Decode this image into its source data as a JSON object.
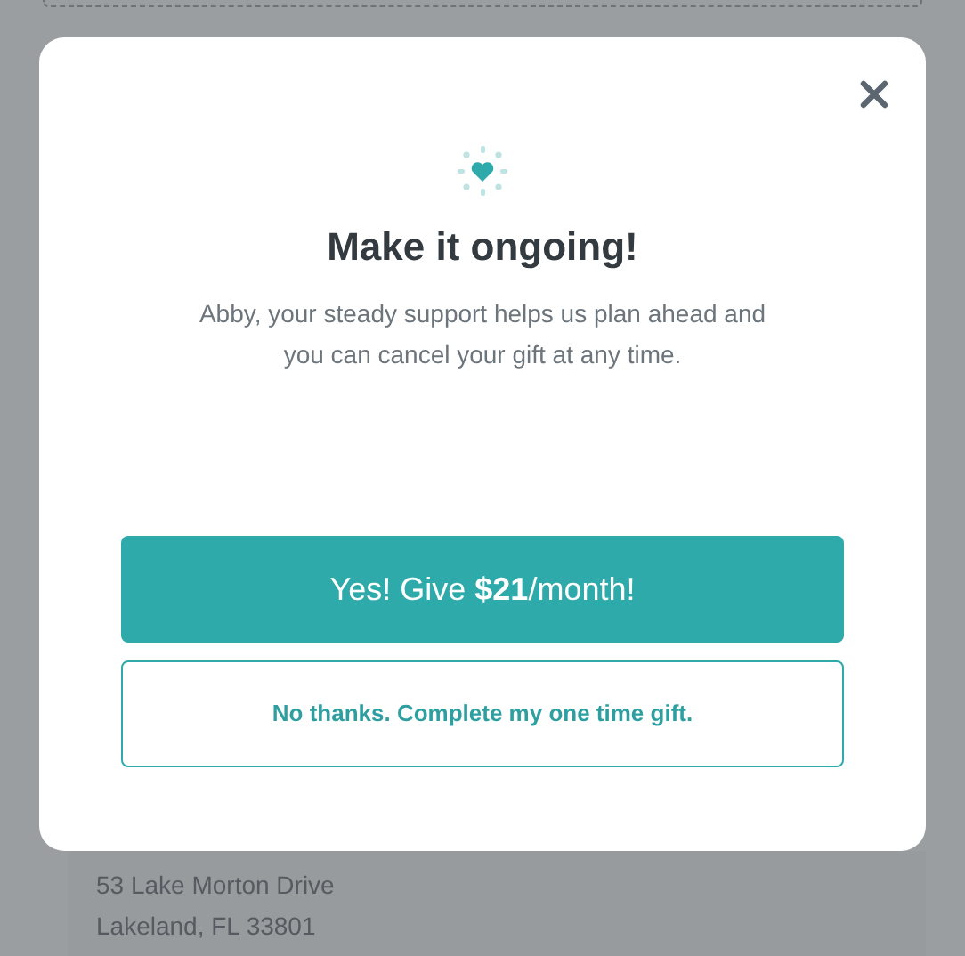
{
  "dialog": {
    "title": "Make it ongoing!",
    "message": "Abby, your steady support helps us plan ahead and you can cancel your gift at any time.",
    "primary_button": "Yes! Give **$21**/month!",
    "secondary_button": "No thanks. Complete my one time gift."
  },
  "address": [
    "53 Lake Morton Drive",
    "Lakeland, FL 33801"
  ]
}
